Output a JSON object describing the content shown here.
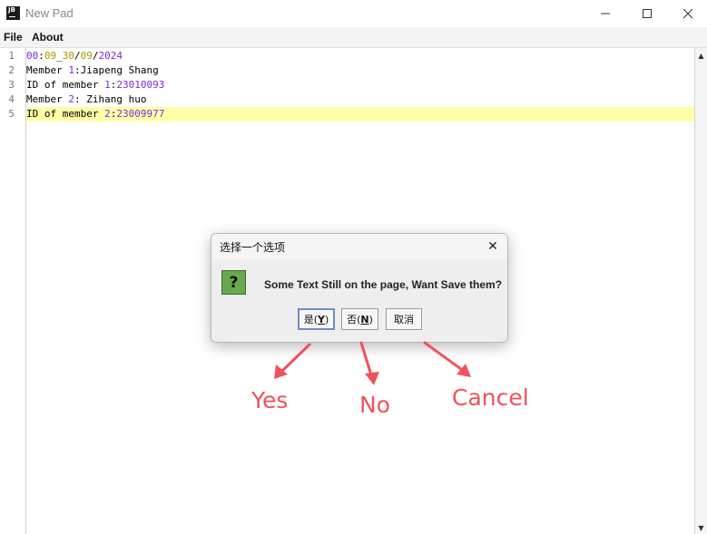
{
  "window": {
    "app_icon": "JB",
    "title": "New Pad",
    "minimize_icon": "minimize-icon",
    "maximize_icon": "maximize-icon",
    "close_icon": "close-icon"
  },
  "menu": {
    "file": "File",
    "about": "About"
  },
  "editor": {
    "line_numbers": [
      "1",
      "2",
      "3",
      "4",
      "5"
    ],
    "lines": [
      [
        {
          "t": "00",
          "c": "num"
        },
        {
          "t": ":",
          "c": ""
        },
        {
          "t": "09",
          "c": "yel"
        },
        {
          "t": "_",
          "c": ""
        },
        {
          "t": "30",
          "c": "yel"
        },
        {
          "t": "/",
          "c": ""
        },
        {
          "t": "09",
          "c": "yel"
        },
        {
          "t": "/",
          "c": ""
        },
        {
          "t": "2024",
          "c": "num"
        }
      ],
      [
        {
          "t": "Member ",
          "c": ""
        },
        {
          "t": "1",
          "c": "num"
        },
        {
          "t": ":Jiapeng Shang",
          "c": ""
        }
      ],
      [
        {
          "t": "ID of member ",
          "c": ""
        },
        {
          "t": "1",
          "c": "num"
        },
        {
          "t": ":",
          "c": ""
        },
        {
          "t": "23010093",
          "c": "num"
        }
      ],
      [
        {
          "t": "Member ",
          "c": ""
        },
        {
          "t": "2",
          "c": "num"
        },
        {
          "t": ": Zihang huo",
          "c": ""
        }
      ],
      [
        {
          "t": "ID of member ",
          "c": ""
        },
        {
          "t": "2",
          "c": "num"
        },
        {
          "t": ":",
          "c": ""
        },
        {
          "t": "23009977",
          "c": "num"
        }
      ]
    ],
    "current_line": "5"
  },
  "scrollbar": {
    "up_arrow": "▲",
    "down_arrow": "▼"
  },
  "dialog": {
    "title": "选择一个选项",
    "close": "✕",
    "icon": "?",
    "message": "Some Text Still on the page, Want Save them?",
    "buttons": {
      "yes_text": "是(",
      "yes_key": "Y",
      "no_text": "否(",
      "no_key": "N",
      "close_paren": ")",
      "cancel": "取消"
    }
  },
  "annotations": {
    "yes": "Yes",
    "no": "No",
    "cancel": "Cancel",
    "color": "#f0525c"
  }
}
